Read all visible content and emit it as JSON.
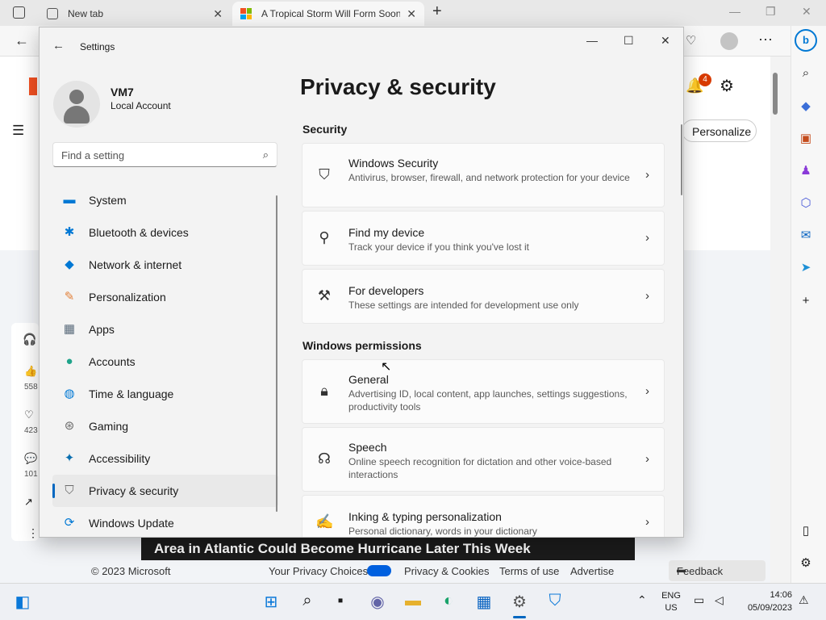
{
  "browser": {
    "tabs": [
      {
        "label": "New tab",
        "close": "✕"
      },
      {
        "label": "A Tropical Storm Will Form Soon",
        "close": "✕"
      }
    ],
    "new_tab": "+",
    "header_button": "Personalize",
    "notification_count": "4",
    "side_counts": [
      "558",
      "423",
      "101"
    ],
    "news_headline": "Area in Atlantic Could Become Hurricane Later This Week",
    "footer": {
      "copyright": "© 2023 Microsoft",
      "privacy_choices": "Your Privacy Choices",
      "privacy_cookies": "Privacy & Cookies",
      "terms": "Terms of use",
      "advertise": "Advertise",
      "feedback": "Feedback"
    }
  },
  "settings": {
    "window_title": "Settings",
    "page_title": "Privacy & security",
    "user": {
      "name": "VM7",
      "account_type": "Local Account"
    },
    "search_placeholder": "Find a setting",
    "nav": [
      {
        "label": "System",
        "icon": "monitor-icon",
        "color": "#0078d4"
      },
      {
        "label": "Bluetooth & devices",
        "icon": "bluetooth-icon",
        "color": "#0078d4"
      },
      {
        "label": "Network & internet",
        "icon": "wifi-icon",
        "color": "#0078d4"
      },
      {
        "label": "Personalization",
        "icon": "brush-icon",
        "color": "#e3823c"
      },
      {
        "label": "Apps",
        "icon": "apps-icon",
        "color": "#5a6b7b"
      },
      {
        "label": "Accounts",
        "icon": "accounts-icon",
        "color": "#1fa38a"
      },
      {
        "label": "Time & language",
        "icon": "globe-icon",
        "color": "#0078d4"
      },
      {
        "label": "Gaming",
        "icon": "gamepad-icon",
        "color": "#6b6b6b"
      },
      {
        "label": "Accessibility",
        "icon": "accessibility-icon",
        "color": "#0a6fb0"
      },
      {
        "label": "Privacy & security",
        "icon": "shield-icon",
        "color": "#6b6b6b"
      },
      {
        "label": "Windows Update",
        "icon": "update-icon",
        "color": "#0078d4"
      }
    ],
    "active_nav": "Privacy & security",
    "sections": {
      "security": "Security",
      "permissions": "Windows permissions"
    },
    "cards": [
      {
        "title": "Windows Security",
        "desc": "Antivirus, browser, firewall, and network protection for your device",
        "icon": "shield-outline-icon"
      },
      {
        "title": "Find my device",
        "desc": "Track your device if you think you've lost it",
        "icon": "find-device-icon"
      },
      {
        "title": "For developers",
        "desc": "These settings are intended for development use only",
        "icon": "developer-tools-icon"
      },
      {
        "title": "General",
        "desc": "Advertising ID, local content, app launches, settings suggestions, productivity tools",
        "icon": "lock-icon"
      },
      {
        "title": "Speech",
        "desc": "Online speech recognition for dictation and other voice-based interactions",
        "icon": "speech-icon"
      },
      {
        "title": "Inking & typing personalization",
        "desc": "Personal dictionary, words in your dictionary",
        "icon": "inking-icon"
      }
    ]
  },
  "taskbar": {
    "lang_primary": "ENG",
    "lang_secondary": "US",
    "time": "14:06",
    "date": "05/09/2023"
  }
}
